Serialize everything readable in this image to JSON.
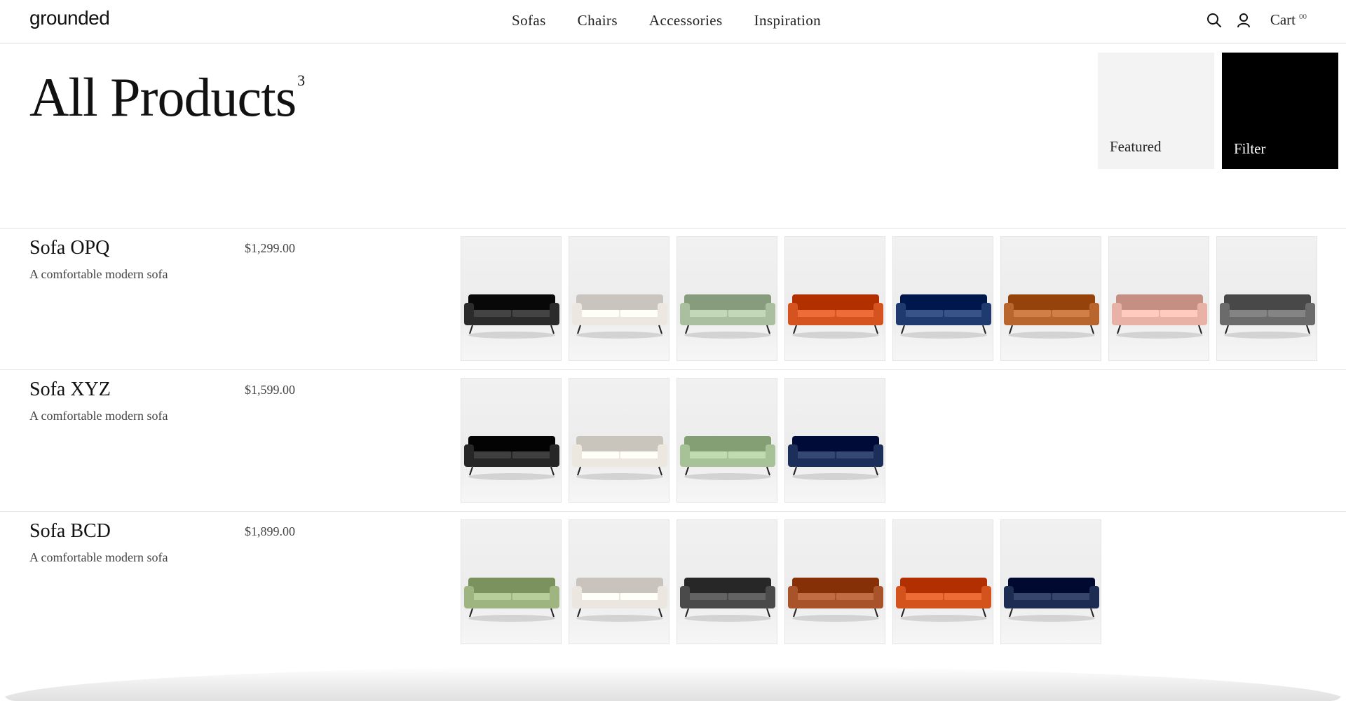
{
  "header": {
    "logo": "grounded",
    "nav": [
      "Sofas",
      "Chairs",
      "Accessories",
      "Inspiration"
    ],
    "icons": [
      "search-icon",
      "user-icon"
    ],
    "cart_label": "Cart",
    "cart_count": "00"
  },
  "page": {
    "title": "All Products",
    "count": "3",
    "featured_label": "Featured",
    "filter_label": "Filter"
  },
  "products": [
    {
      "name": "Sofa OPQ",
      "description": "A comfortable modern sofa",
      "price": "$1,299.00",
      "swatches": [
        "#2b2b2b",
        "#ece8e1",
        "#a9bfa0",
        "#d5531f",
        "#1e3a6e",
        "#b8662e",
        "#e8b3a6",
        "#6b6b6b"
      ]
    },
    {
      "name": "Sofa XYZ",
      "description": "A comfortable modern sofa",
      "price": "$1,599.00",
      "swatches": [
        "#262626",
        "#ece7df",
        "#a8c298",
        "#1b2f5a"
      ]
    },
    {
      "name": "Sofa BCD",
      "description": "A comfortable modern sofa",
      "price": "$1,899.00",
      "swatches": [
        "#9fb581",
        "#ebe7e0",
        "#4a4a4a",
        "#a9532a",
        "#d4521c",
        "#1c2c52"
      ]
    }
  ]
}
